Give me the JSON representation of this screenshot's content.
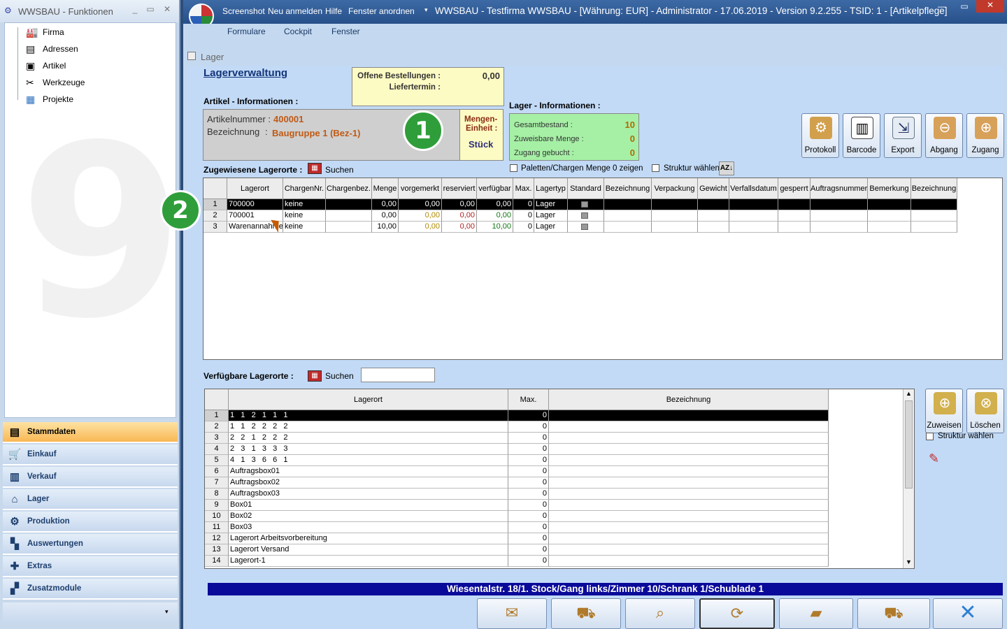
{
  "left_window": {
    "title": "WWSBAU - Funktionen",
    "tree": [
      {
        "label": "Firma",
        "icon": "factory-icon"
      },
      {
        "label": "Adressen",
        "icon": "address-card-icon"
      },
      {
        "label": "Artikel",
        "icon": "box-icon"
      },
      {
        "label": "Werkzeuge",
        "icon": "tools-icon"
      },
      {
        "label": "Projekte",
        "icon": "project-icon"
      }
    ],
    "nav": [
      {
        "label": "Stammdaten",
        "icon": "stammdaten-icon",
        "active": true
      },
      {
        "label": "Einkauf",
        "icon": "cart-icon"
      },
      {
        "label": "Verkauf",
        "icon": "cash-register-icon"
      },
      {
        "label": "Lager",
        "icon": "warehouse-icon"
      },
      {
        "label": "Produktion",
        "icon": "production-icon"
      },
      {
        "label": "Auswertungen",
        "icon": "chart-icon"
      },
      {
        "label": "Extras",
        "icon": "extras-icon"
      },
      {
        "label": "Zusatzmodule",
        "icon": "modules-icon"
      }
    ]
  },
  "main_window": {
    "menu_top": [
      "Screenshot",
      "Neu anmelden",
      "Hilfe",
      "Fenster anordnen"
    ],
    "caption": "WWSBAU - Testfirma WWSBAU - [Währung: EUR] - Administrator - 17.06.2019 - Version 9.2.255 - TSID: 1 - [Artikelpflege]",
    "menu": [
      "Formulare",
      "Cockpit",
      "Fenster"
    ],
    "subwindow_title": "Lager"
  },
  "lager": {
    "heading": "Lagerverwaltung",
    "offene_label": "Offene Bestellungen :",
    "offene_value": "0,00",
    "liefertermin_label": "Liefertermin :",
    "artikel_info_heading": "Artikel - Informationen :",
    "artikelnummer_label": "Artikelnummer :",
    "artikelnummer_value": "400001",
    "bezeichnung_label": "Bezeichnung",
    "bezeichnung_colon": ":",
    "bezeichnung_value": "Baugruppe 1  (Bez-1)",
    "mengen_label1": "Mengen-",
    "mengen_label2": "Einheit :",
    "mengen_value": "Stück",
    "lager_info_heading": "Lager - Informationen :",
    "gesamtbestand_label": "Gesamtbestand :",
    "gesamtbestand_value": "10",
    "zuweisbar_label": "Zuweisbare Menge :",
    "zuweisbar_value": "0",
    "zugang_label": "Zugang gebucht :",
    "zugang_value": "0",
    "toolbar": [
      "Protokoll",
      "Barcode",
      "Export",
      "Abgang",
      "Zugang"
    ],
    "zugewiesene_label": "Zugewiesene Lagerorte :",
    "suchen_label": "Suchen",
    "paletten_label": "Paletten/Chargen Menge 0 zeigen",
    "struktur_label": "Struktur wählen",
    "assigned_columns": [
      "Lagerort",
      "ChargenNr.",
      "Chargenbez.",
      "Menge",
      "vorgemerkt",
      "reserviert",
      "verfügbar",
      "Max.",
      "Lagertyp",
      "Standard",
      "Bezeichnung",
      "Verpackung",
      "Gewicht",
      "Verfallsdatum",
      "gesperrt",
      "Auftragsnummer",
      "Bemerkung",
      "Bezeichnung"
    ],
    "assigned_rows": [
      {
        "n": "1",
        "lagerort": "700000",
        "charge": "keine",
        "chargenbez": "",
        "menge": "0,00",
        "vorgemerkt": "0,00",
        "reserviert": "0,00",
        "verfuegbar": "0,00",
        "max": "0",
        "typ": "Lager"
      },
      {
        "n": "2",
        "lagerort": "700001",
        "charge": "keine",
        "chargenbez": "",
        "menge": "0,00",
        "vorgemerkt": "0,00",
        "reserviert": "0,00",
        "verfuegbar": "0,00",
        "max": "0",
        "typ": "Lager"
      },
      {
        "n": "3",
        "lagerort": "Warenannahme",
        "charge": "keine",
        "chargenbez": "",
        "menge": "10,00",
        "vorgemerkt": "0,00",
        "reserviert": "0,00",
        "verfuegbar": "10,00",
        "max": "0",
        "typ": "Lager"
      }
    ],
    "verfuegbare_label": "Verfügbare Lagerorte :",
    "suchen2_label": "Suchen",
    "suchen2_value": "",
    "available_columns": [
      "Lagerort",
      "Max.",
      "Bezeichnung"
    ],
    "available_rows": [
      {
        "n": "1",
        "lagerort": "1   1   2   1   1   1",
        "max": "0"
      },
      {
        "n": "2",
        "lagerort": "1   1   2   2   2   2",
        "max": "0"
      },
      {
        "n": "3",
        "lagerort": "2   2   1   2   2   2",
        "max": "0"
      },
      {
        "n": "4",
        "lagerort": "2   3   1   3   3   3",
        "max": "0"
      },
      {
        "n": "5",
        "lagerort": "4   1   3   6   6   1",
        "max": "0"
      },
      {
        "n": "6",
        "lagerort": "Auftragsbox01",
        "max": "0"
      },
      {
        "n": "7",
        "lagerort": "Auftragsbox02",
        "max": "0"
      },
      {
        "n": "8",
        "lagerort": "Auftragsbox03",
        "max": "0"
      },
      {
        "n": "9",
        "lagerort": "Box01",
        "max": "0"
      },
      {
        "n": "10",
        "lagerort": "Box02",
        "max": "0"
      },
      {
        "n": "11",
        "lagerort": "Box03",
        "max": "0"
      },
      {
        "n": "12",
        "lagerort": "Lagerort Arbeitsvorbereitung",
        "max": "0"
      },
      {
        "n": "13",
        "lagerort": "Lagerort Versand",
        "max": "0"
      },
      {
        "n": "14",
        "lagerort": "Lagerort-1",
        "max": "0"
      }
    ],
    "zuweisen_label": "Zuweisen",
    "loeschen_label": "Löschen",
    "struktur2_label": "Struktur wählen",
    "status_text": "Wiesentalstr. 18/1. Stock/Gang links/Zimmer 10/Schrank 1/Schublade 1",
    "badge1": "1",
    "badge2": "2"
  }
}
